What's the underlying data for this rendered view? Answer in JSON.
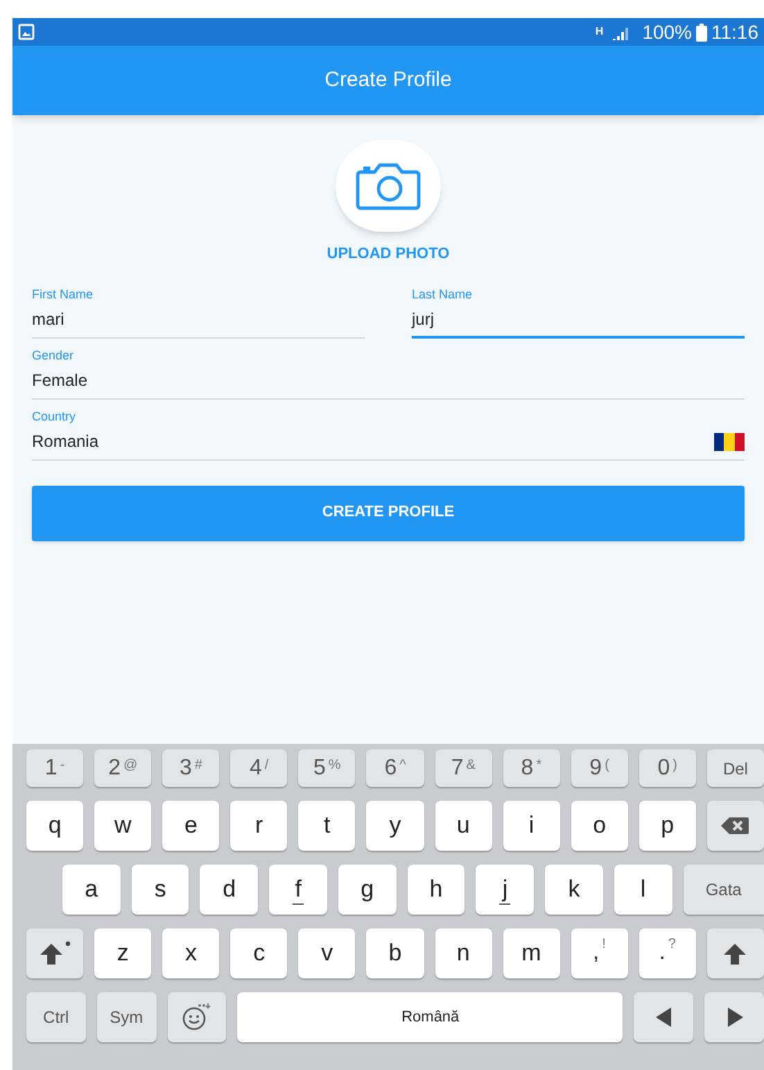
{
  "status_bar": {
    "network": "H",
    "battery": "100%",
    "time": "11:16"
  },
  "app_bar": {
    "title": "Create Profile"
  },
  "upload": {
    "label": "UPLOAD PHOTO"
  },
  "field_rows": [
    [
      {
        "kind": "text",
        "label": "First Name",
        "value": "mari",
        "focused": false
      },
      {
        "kind": "text",
        "label": "Last Name",
        "value": "jurj",
        "focused": true
      }
    ],
    [
      {
        "kind": "text",
        "label": "Gender",
        "value": "Female",
        "focused": false
      }
    ],
    [
      {
        "kind": "country",
        "label": "Country",
        "value": "Romania",
        "focused": false
      }
    ]
  ],
  "button": {
    "label": "CREATE PROFILE"
  },
  "keyboard": {
    "key_lines": [
      {
        "keys": [
          {
            "kind": "dual",
            "label": "1",
            "sub": "-"
          },
          {
            "kind": "dual",
            "label": "2",
            "sub": "@"
          },
          {
            "kind": "dual",
            "label": "3",
            "sub": "#"
          },
          {
            "kind": "dual",
            "label": "4",
            "sub": "/"
          },
          {
            "kind": "dual",
            "label": "5",
            "sub": "%"
          },
          {
            "kind": "dual",
            "label": "6",
            "sub": "^"
          },
          {
            "kind": "dual",
            "label": "7",
            "sub": "&"
          },
          {
            "kind": "dual",
            "label": "8",
            "sub": "*"
          },
          {
            "kind": "dual",
            "label": "9",
            "sub": "("
          },
          {
            "kind": "dual",
            "label": "0",
            "sub": ")"
          },
          {
            "kind": "function",
            "label": "Del"
          }
        ]
      },
      {
        "keys": [
          {
            "kind": "letter",
            "label": "q",
            "bump": false
          },
          {
            "kind": "letter",
            "label": "w",
            "bump": false
          },
          {
            "kind": "letter",
            "label": "e",
            "bump": false
          },
          {
            "kind": "letter",
            "label": "r",
            "bump": false
          },
          {
            "kind": "letter",
            "label": "t",
            "bump": false
          },
          {
            "kind": "letter",
            "label": "y",
            "bump": false
          },
          {
            "kind": "letter",
            "label": "u",
            "bump": false
          },
          {
            "kind": "letter",
            "label": "i",
            "bump": false
          },
          {
            "kind": "letter",
            "label": "o",
            "bump": false
          },
          {
            "kind": "letter",
            "label": "p",
            "bump": false
          },
          {
            "kind": "backspace"
          }
        ]
      },
      {
        "keys": [
          {
            "kind": "letter",
            "label": "a",
            "bump": false
          },
          {
            "kind": "letter",
            "label": "s",
            "bump": false
          },
          {
            "kind": "letter",
            "label": "d",
            "bump": false
          },
          {
            "kind": "letter",
            "label": "f",
            "bump": true
          },
          {
            "kind": "letter",
            "label": "g",
            "bump": false
          },
          {
            "kind": "letter",
            "label": "h",
            "bump": false
          },
          {
            "kind": "letter",
            "label": "j",
            "bump": true
          },
          {
            "kind": "letter",
            "label": "k",
            "bump": false
          },
          {
            "kind": "letter",
            "label": "l",
            "bump": false
          },
          {
            "kind": "action",
            "label": "Gata"
          }
        ]
      },
      {
        "keys": [
          {
            "kind": "caps-shift"
          },
          {
            "kind": "letter",
            "label": "z",
            "bump": false
          },
          {
            "kind": "letter",
            "label": "x",
            "bump": false
          },
          {
            "kind": "letter",
            "label": "c",
            "bump": false
          },
          {
            "kind": "letter",
            "label": "v",
            "bump": false
          },
          {
            "kind": "letter",
            "label": "b",
            "bump": false
          },
          {
            "kind": "letter",
            "label": "n",
            "bump": false
          },
          {
            "kind": "letter",
            "label": "m",
            "bump": false
          },
          {
            "kind": "punct",
            "label": ",",
            "sub": "!"
          },
          {
            "kind": "punct",
            "label": ".",
            "sub": "?"
          },
          {
            "kind": "shift"
          }
        ]
      },
      {
        "keys": [
          {
            "kind": "function",
            "label": "Ctrl"
          },
          {
            "kind": "function",
            "label": "Sym"
          },
          {
            "kind": "emoji"
          },
          {
            "kind": "space",
            "label": "Română"
          },
          {
            "kind": "left"
          },
          {
            "kind": "right"
          }
        ]
      }
    ]
  }
}
